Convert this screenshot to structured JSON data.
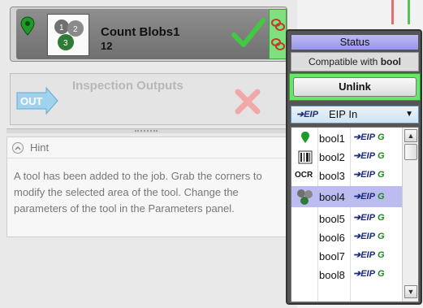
{
  "tool": {
    "name": "Count Blobs1",
    "count": "12"
  },
  "outputs": {
    "title": "Inspection Outputs",
    "out_label": "OUT"
  },
  "hint": {
    "title": "Hint",
    "text": "A tool has been added to the job. Grab the corners to modify the selected area of the tool. Change the parameters of the tool in the Parameters panel."
  },
  "popup": {
    "status": "Status",
    "compatible_prefix": "Compatible with",
    "compatible_type": "bool",
    "unlink": "Unlink",
    "eip_badge": "EIP",
    "dropdown_value": "EIP In",
    "eip_g_text": "EIP",
    "eip_g_letter": "G",
    "items": [
      {
        "name": "bool1",
        "icon": "pin-icon"
      },
      {
        "name": "bool2",
        "icon": "barcode-icon"
      },
      {
        "name": "bool3",
        "icon": "ocr-icon",
        "icon_text": "OCR"
      },
      {
        "name": "bool4",
        "icon": "blobs-icon",
        "selected": true
      },
      {
        "name": "bool5"
      },
      {
        "name": "bool6"
      },
      {
        "name": "bool7"
      },
      {
        "name": "bool8"
      }
    ]
  },
  "colors": {
    "accent_green": "#6ae46a",
    "status_purple": "#9a97e6",
    "selection": "#bcbcf0"
  }
}
